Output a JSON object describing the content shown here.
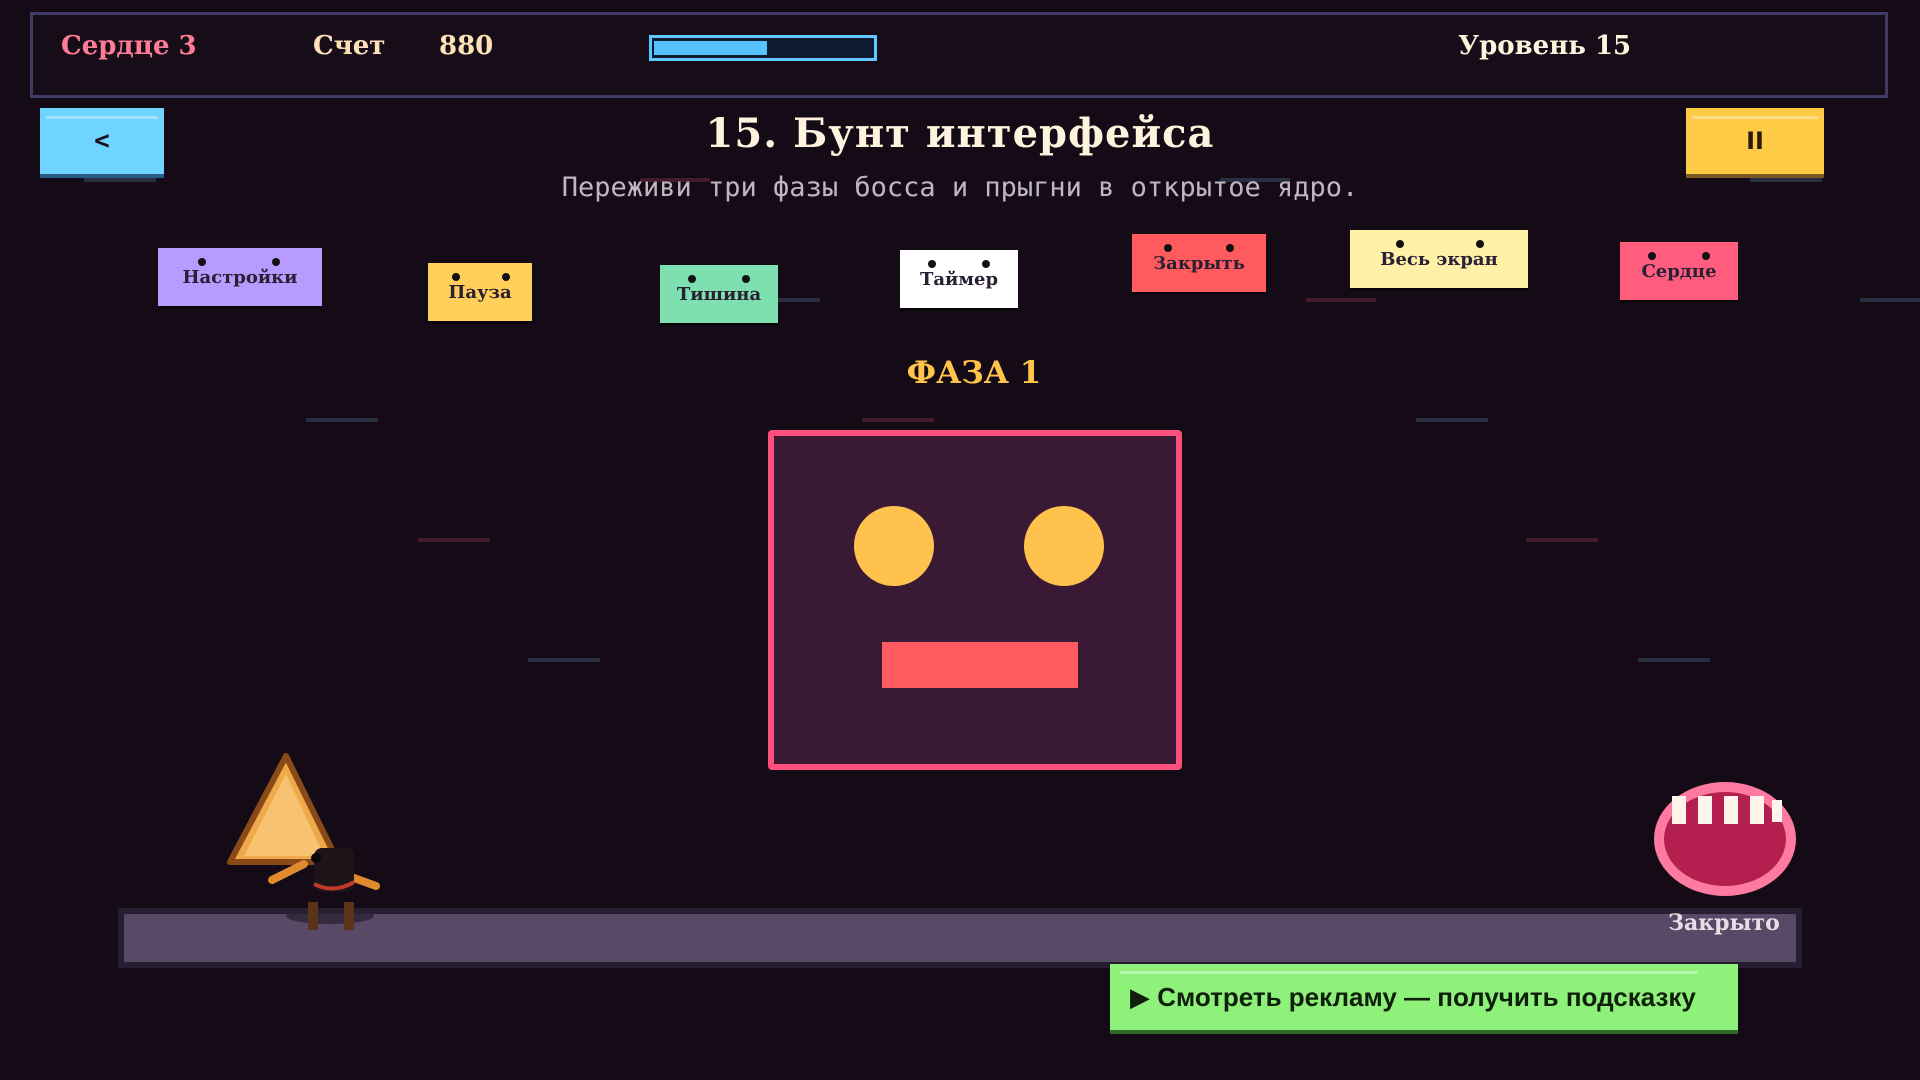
{
  "hud": {
    "hearts_label": "Сердце 3",
    "score_label": "Счет",
    "score_value": "880",
    "progress": 0.52,
    "level_label": "Уровень 15"
  },
  "controls": {
    "back_label": "<",
    "pause_label": "II"
  },
  "level": {
    "title": "15. Бунт интерфейса",
    "subtitle": "Переживи три фазы босса и прыгни в открытое ядро.",
    "phase_label": "ФАЗА 1"
  },
  "ui_enemies": [
    {
      "label": "Настройки",
      "color": "#b79bff"
    },
    {
      "label": "Пауза",
      "color": "#ffcf59"
    },
    {
      "label": "Тишина",
      "color": "#7ee0b0"
    },
    {
      "label": "Таймер",
      "color": "#ffffff"
    },
    {
      "label": "Закрыть",
      "color": "#ff5b5e"
    },
    {
      "label": "Весь экран",
      "color": "#fff0a8"
    },
    {
      "label": "Сердце",
      "color": "#ff5c7e"
    }
  ],
  "core": {
    "status_label": "Закрыто"
  },
  "ad": {
    "label": "▶ Смотреть рекламу — получить подсказку"
  },
  "colors": {
    "background": "#150b16",
    "boss_border": "#ff4f7c",
    "boss_eye": "#ffc34d",
    "boss_mouth": "#ff5a60",
    "accent_blue": "#6fd4ff",
    "accent_yellow": "#ffcb47",
    "ad_green": "#8ef27a"
  }
}
